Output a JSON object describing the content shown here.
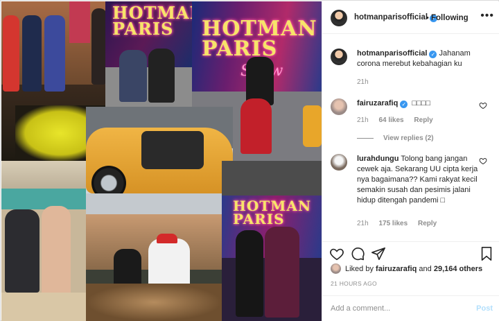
{
  "post": {
    "author": "hotmanparisofficial",
    "follow_label": "Following",
    "dot": "•",
    "more_label": "•••"
  },
  "caption": {
    "username": "hotmanparisofficial",
    "text": "Jahanam corona merebut kebahagian ku",
    "time": "21h"
  },
  "comments": [
    {
      "username": "fairuzarafiq",
      "verified": true,
      "text": "□□□□",
      "time": "21h",
      "likes": "64 likes",
      "reply_label": "Reply",
      "view_replies": "View replies (2)"
    },
    {
      "username": "lurahdungu",
      "verified": false,
      "text": "Tolong bang jangan cewek aja. Sekarang UU cipta kerja nya bagaimana?? Kami rakyat kecil semakin susah dan pesimis jalani hidup ditengah pandemi □",
      "time": "21h",
      "likes": "175 likes",
      "reply_label": "Reply"
    }
  ],
  "likes": {
    "prefix": "Liked by",
    "user": "fairuzarafiq",
    "and": "and",
    "count": "29,164 others"
  },
  "timestamp": "21 HOURS AGO",
  "add_comment": {
    "placeholder": "Add a comment...",
    "post_label": "Post"
  },
  "collage": {
    "logo_top": "HOTMAN",
    "logo_mid": "PARIS",
    "logo_sub": "Show",
    "logo_small_top": "HOTMAN",
    "logo_small_mid": "PARIS"
  },
  "colors": {
    "verified": "#3897f0",
    "post_disabled": "#b2dffc",
    "muted": "#8e8e8e"
  },
  "icons": [
    "heart-icon",
    "comment-icon",
    "share-icon",
    "bookmark-icon",
    "verified-badge-icon",
    "more-options-icon"
  ]
}
